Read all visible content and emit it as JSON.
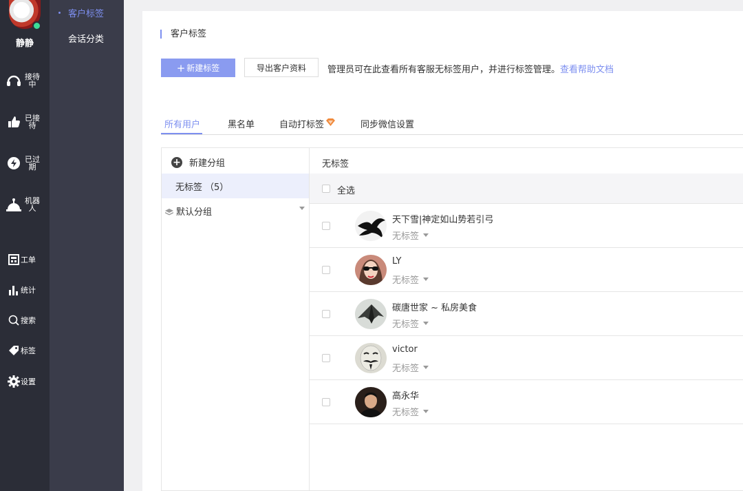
{
  "user": {
    "name": "静静",
    "status_color": "#3ddc97"
  },
  "rail": {
    "items": [
      {
        "icon": "headset-icon",
        "label": "接待中"
      },
      {
        "icon": "done-icon",
        "label": "已接待"
      },
      {
        "icon": "expired-icon",
        "label": "已过期"
      },
      {
        "icon": "robot-icon",
        "label": "机器人"
      }
    ],
    "tools": [
      {
        "icon": "ticket-icon",
        "label": "工单"
      },
      {
        "icon": "stats-icon",
        "label": "统计"
      },
      {
        "icon": "search-icon",
        "label": "搜索"
      },
      {
        "icon": "tag-icon",
        "label": "标签"
      },
      {
        "icon": "gear-icon",
        "label": "设置"
      }
    ]
  },
  "subnav": {
    "items": [
      {
        "label": "客户标签",
        "active": true
      },
      {
        "label": "会话分类",
        "active": false
      }
    ]
  },
  "main": {
    "title": "客户标签",
    "new_tag_label": "新建标签",
    "export_label": "导出客户资料",
    "notice_text": "管理员可在此查看所有客服无标签用户，并进行标签管理。",
    "help_link": "查看帮助文档",
    "tabs": [
      {
        "label": "所有用户",
        "active": true
      },
      {
        "label": "黑名单"
      },
      {
        "label": "自动打标签",
        "badge": "vip-diamond-icon"
      },
      {
        "label": "同步微信设置"
      }
    ]
  },
  "groups": {
    "new_group_label": "新建分组",
    "untagged_label": "无标签",
    "untagged_count": "（5）",
    "default_group_label": "默认分组"
  },
  "list": {
    "title": "无标签",
    "select_all_label": "全选",
    "users": [
      {
        "name": "天下雪|神定如山势若引弓",
        "tag": "无标签",
        "avatar": "ink-bird-avatar"
      },
      {
        "name": "LY",
        "tag": "无标签",
        "avatar": "woman-sunglasses-avatar"
      },
      {
        "name": "碳唐世家 ~ 私房美食",
        "tag": "无标签",
        "avatar": "stealth-plane-avatar"
      },
      {
        "name": "victor",
        "tag": "无标签",
        "avatar": "guy-fawkes-mask-avatar"
      },
      {
        "name": "高永华",
        "tag": "无标签",
        "avatar": "man-portrait-avatar"
      }
    ]
  },
  "colors": {
    "accent": "#7d8ff0",
    "primary_button": "#8a9bf0",
    "rail_bg": "#2b2d37",
    "subnav_bg": "#3a3c4a"
  }
}
